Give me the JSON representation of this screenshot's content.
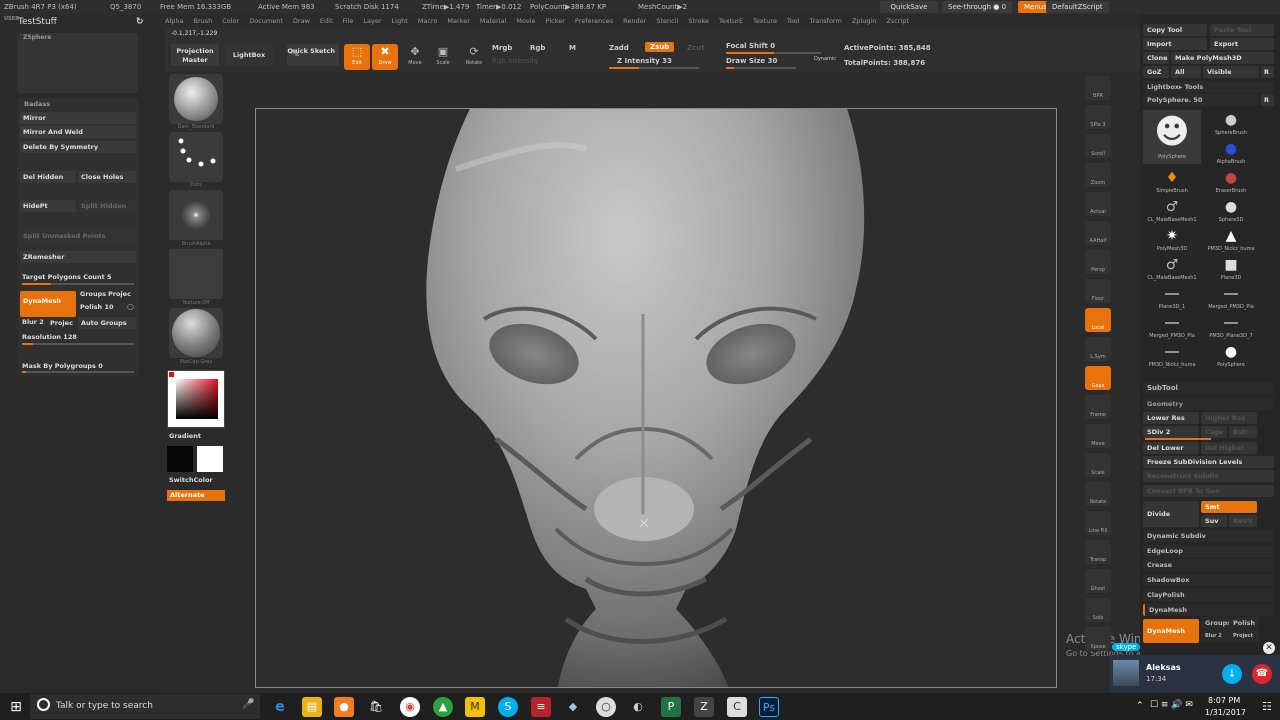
{
  "titlebar": {
    "app": "ZBrush 4R7 P3 (x64)",
    "project": "Q5_3870",
    "stats": [
      "Free Mem 16.333GB",
      "Active Mem 983",
      "Scratch Disk 1174",
      "ZTime▶1.479",
      "Timer▶0.012",
      "PolyCount▶388.87 KP",
      "MeshCount▶2"
    ],
    "quicksave": "QuickSave",
    "seethrough": "See-through ● 0",
    "menus": "Menus",
    "defaultzscript": "DefaultZScript"
  },
  "menubar": [
    "Alpha",
    "Brush",
    "Color",
    "Document",
    "Draw",
    "Edit",
    "File",
    "Layer",
    "Light",
    "Macro",
    "Marker",
    "Material",
    "Movie",
    "Picker",
    "Preferences",
    "Render",
    "Stencil",
    "Stroke",
    "TexturE",
    "Texture",
    "Tool",
    "Transform",
    "Zplugin",
    "Zscript"
  ],
  "coords": "-0.1,217,-1.229",
  "topbar": {
    "projection_master": "Projection Master",
    "lightbox": "LightBox",
    "quick_sketch": "Quick Sketch",
    "tools": [
      "Edit",
      "Draw",
      "Move",
      "Scale",
      "Rotate"
    ],
    "mrgb": "Mrgb",
    "rgb": "Rgb",
    "m": "M",
    "zadd": "Zadd",
    "zsub": "Zsub",
    "zcut": "Zcut",
    "rgb_intensity": "Rgb Intensity",
    "z_intensity": "Z Intensity 33",
    "focal_shift": "Focal Shift 0",
    "draw_size": "Draw Size 30",
    "dynamic": "Dynamic",
    "active_points": "ActivePoints: 385,848",
    "total_points": "TotalPoints: 388,876"
  },
  "leftpanel": {
    "doc_title": "TestStuff",
    "zsphere": "ZSphere",
    "section": "Badass",
    "mirror": "Mirror",
    "mirror_weld": "Mirror And Weld",
    "delete_symmetry": "Delete By Symmetry",
    "del_hidden": "Del Hidden",
    "close_holes": "Close Holes",
    "hidept": "HidePt",
    "split_hidden": "Split Hidden",
    "split_unmasked": "Split Unmasked Points",
    "zremesher": "ZRemesher",
    "target_polygons": "Target Polygons Count 5",
    "dynamesh": "DynaMesh",
    "groups": "Groups",
    "project": "Projec",
    "polish": "Polish 10",
    "blur": "Blur 2",
    "projec2": "Projec",
    "auto_groups": "Auto Groups",
    "resolution": "Resolution 128",
    "mask_polygroups": "Mask By Polygroups 0"
  },
  "brushcol": {
    "thumbs": [
      "Dam_Standard",
      "Dots",
      "BrushAlpha",
      "Texture Off",
      "MatCap Gray"
    ],
    "gradient": "Gradient",
    "switchcolor": "SwitchColor",
    "alternate": "Alternate"
  },
  "rightshelf": [
    "BPR",
    "SPix 3",
    "Scroll",
    "Zoom",
    "Actual",
    "AAHalf",
    "Persp",
    "Floor",
    "Local",
    "L.Sym",
    "Gxyz",
    "Frame",
    "Move",
    "Scale",
    "Rotate",
    "Line Fill PolyF",
    "Transp",
    "Ghost",
    "Solo",
    "Xpose"
  ],
  "rightpanel": {
    "copy_tool": "Copy Tool",
    "paste_tool": "Paste Tool",
    "import": "Import",
    "export": "Export",
    "clone": "Clone",
    "make_polymesh": "Make PolyMesh3D",
    "goz": "GoZ",
    "all": "All",
    "visible": "Visible",
    "r": "R",
    "lightbox_tools": "Lightbox▸ Tools",
    "polysphere": "PolySphere. 50",
    "tools": [
      "PolySphere",
      "SphereBrush",
      "AlphaBrush",
      "SimpleBrush",
      "EraserBrush",
      "CL_MaleBaseMesh1",
      "Sphere3D",
      "PolyMesh3D",
      "PM3D_Nickz_huma",
      "CL_MaleBaseMesh1",
      "Plane3D",
      "Plane3D_1",
      "Merged_PM3D_Pla",
      "Merged_PM3D_Pla",
      "PM3D_Plane3D_7",
      "PM3D_Nickz_huma",
      "PolySphere"
    ],
    "subtool": "SubTool",
    "geometry": "Geometry",
    "lower_res": "Lower Res",
    "higher_res": "Higher Res",
    "sdiv": "SDiv 2",
    "cage": "Cage",
    "rstr": "Rstr",
    "del_lower": "Del Lower",
    "del_higher": "Del Higher",
    "freeze": "Freeze SubDivision Levels",
    "reconstruct": "Reconstruct Subdiv",
    "convert_bpr": "Convert BPR To Geo",
    "divide": "Divide",
    "smt": "Smt",
    "suv": "Suv",
    "reuv": "ReUV",
    "dynamic_subdiv": "Dynamic Subdiv",
    "edgeloop": "EdgeLoop",
    "crease": "Crease",
    "shadowbox": "ShadowBox",
    "claypolish": "ClayPolish",
    "dynamesh_head": "DynaMesh",
    "dynamesh": "DynaMesh",
    "groups": "Groups",
    "polish": "Polish",
    "blur": "Blur 2",
    "project": "Project"
  },
  "watermark": {
    "line1": "Activate Windows",
    "line2": "Go to Settings to activate Windows."
  },
  "skype": {
    "name": "Aleksas",
    "time": "17:34",
    "brand": "skype"
  },
  "taskbar": {
    "search": "Talk or type to search",
    "time": "8:07 PM",
    "date": "1/31/2017"
  }
}
